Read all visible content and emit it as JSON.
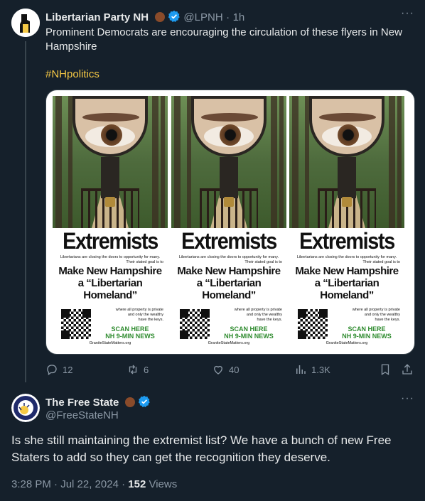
{
  "colors": {
    "background": "#15202b",
    "text": "#e7e9ea",
    "muted": "#8b98a5",
    "hashtag": "#f6c945",
    "verified": "#1d9bf0",
    "divider": "#38444d"
  },
  "tweet": {
    "author_name": "Libertarian Party NH",
    "author_handle": "@LPNH",
    "time": "1h",
    "text": "Prominent Democrats are encouraging the circulation of these flyers in New Hampshire",
    "hashtag": "#NHpolitics",
    "flyer": {
      "title": "Extremists",
      "line1": "Libertarians are closing the doors to opportunity for many.",
      "line2": "Their stated goal is to",
      "headline1": "Make New Hampshire",
      "headline2": "a “Libertarian",
      "headline3": "Homeland”",
      "note1": "where all property is private",
      "note2": "and only the wealthy",
      "note3": "have the keys.",
      "scan1": "SCAN HERE",
      "scan2": "NH 9-MIN NEWS",
      "site": "GraniteStateMatters.org"
    },
    "stats": {
      "replies": "12",
      "reposts": "6",
      "likes": "40",
      "views": "1.3K"
    }
  },
  "reply": {
    "author_name": "The Free State",
    "author_handle": "@FreeStateNH",
    "text": "Is she still maintaining the extremist list? We have a bunch of new Free Staters to add so they can get the recognition they deserve.",
    "timestamp": "3:28 PM · Jul 22, 2024 ·",
    "views_count": "152",
    "views_label": "Views"
  },
  "icons": [
    "reply-icon",
    "repost-icon",
    "like-icon",
    "views-icon",
    "bookmark-icon",
    "share-icon",
    "verified-icon",
    "more-icon"
  ]
}
